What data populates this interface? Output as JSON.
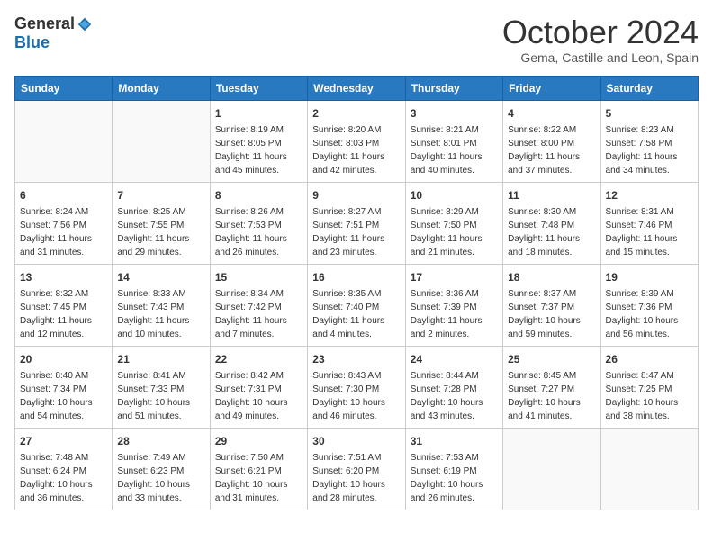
{
  "logo": {
    "general": "General",
    "blue": "Blue"
  },
  "title": {
    "month": "October 2024",
    "location": "Gema, Castille and Leon, Spain"
  },
  "weekdays": [
    "Sunday",
    "Monday",
    "Tuesday",
    "Wednesday",
    "Thursday",
    "Friday",
    "Saturday"
  ],
  "weeks": [
    [
      {
        "day": "",
        "sunrise": "",
        "sunset": "",
        "daylight": ""
      },
      {
        "day": "",
        "sunrise": "",
        "sunset": "",
        "daylight": ""
      },
      {
        "day": "1",
        "sunrise": "Sunrise: 8:19 AM",
        "sunset": "Sunset: 8:05 PM",
        "daylight": "Daylight: 11 hours and 45 minutes."
      },
      {
        "day": "2",
        "sunrise": "Sunrise: 8:20 AM",
        "sunset": "Sunset: 8:03 PM",
        "daylight": "Daylight: 11 hours and 42 minutes."
      },
      {
        "day": "3",
        "sunrise": "Sunrise: 8:21 AM",
        "sunset": "Sunset: 8:01 PM",
        "daylight": "Daylight: 11 hours and 40 minutes."
      },
      {
        "day": "4",
        "sunrise": "Sunrise: 8:22 AM",
        "sunset": "Sunset: 8:00 PM",
        "daylight": "Daylight: 11 hours and 37 minutes."
      },
      {
        "day": "5",
        "sunrise": "Sunrise: 8:23 AM",
        "sunset": "Sunset: 7:58 PM",
        "daylight": "Daylight: 11 hours and 34 minutes."
      }
    ],
    [
      {
        "day": "6",
        "sunrise": "Sunrise: 8:24 AM",
        "sunset": "Sunset: 7:56 PM",
        "daylight": "Daylight: 11 hours and 31 minutes."
      },
      {
        "day": "7",
        "sunrise": "Sunrise: 8:25 AM",
        "sunset": "Sunset: 7:55 PM",
        "daylight": "Daylight: 11 hours and 29 minutes."
      },
      {
        "day": "8",
        "sunrise": "Sunrise: 8:26 AM",
        "sunset": "Sunset: 7:53 PM",
        "daylight": "Daylight: 11 hours and 26 minutes."
      },
      {
        "day": "9",
        "sunrise": "Sunrise: 8:27 AM",
        "sunset": "Sunset: 7:51 PM",
        "daylight": "Daylight: 11 hours and 23 minutes."
      },
      {
        "day": "10",
        "sunrise": "Sunrise: 8:29 AM",
        "sunset": "Sunset: 7:50 PM",
        "daylight": "Daylight: 11 hours and 21 minutes."
      },
      {
        "day": "11",
        "sunrise": "Sunrise: 8:30 AM",
        "sunset": "Sunset: 7:48 PM",
        "daylight": "Daylight: 11 hours and 18 minutes."
      },
      {
        "day": "12",
        "sunrise": "Sunrise: 8:31 AM",
        "sunset": "Sunset: 7:46 PM",
        "daylight": "Daylight: 11 hours and 15 minutes."
      }
    ],
    [
      {
        "day": "13",
        "sunrise": "Sunrise: 8:32 AM",
        "sunset": "Sunset: 7:45 PM",
        "daylight": "Daylight: 11 hours and 12 minutes."
      },
      {
        "day": "14",
        "sunrise": "Sunrise: 8:33 AM",
        "sunset": "Sunset: 7:43 PM",
        "daylight": "Daylight: 11 hours and 10 minutes."
      },
      {
        "day": "15",
        "sunrise": "Sunrise: 8:34 AM",
        "sunset": "Sunset: 7:42 PM",
        "daylight": "Daylight: 11 hours and 7 minutes."
      },
      {
        "day": "16",
        "sunrise": "Sunrise: 8:35 AM",
        "sunset": "Sunset: 7:40 PM",
        "daylight": "Daylight: 11 hours and 4 minutes."
      },
      {
        "day": "17",
        "sunrise": "Sunrise: 8:36 AM",
        "sunset": "Sunset: 7:39 PM",
        "daylight": "Daylight: 11 hours and 2 minutes."
      },
      {
        "day": "18",
        "sunrise": "Sunrise: 8:37 AM",
        "sunset": "Sunset: 7:37 PM",
        "daylight": "Daylight: 10 hours and 59 minutes."
      },
      {
        "day": "19",
        "sunrise": "Sunrise: 8:39 AM",
        "sunset": "Sunset: 7:36 PM",
        "daylight": "Daylight: 10 hours and 56 minutes."
      }
    ],
    [
      {
        "day": "20",
        "sunrise": "Sunrise: 8:40 AM",
        "sunset": "Sunset: 7:34 PM",
        "daylight": "Daylight: 10 hours and 54 minutes."
      },
      {
        "day": "21",
        "sunrise": "Sunrise: 8:41 AM",
        "sunset": "Sunset: 7:33 PM",
        "daylight": "Daylight: 10 hours and 51 minutes."
      },
      {
        "day": "22",
        "sunrise": "Sunrise: 8:42 AM",
        "sunset": "Sunset: 7:31 PM",
        "daylight": "Daylight: 10 hours and 49 minutes."
      },
      {
        "day": "23",
        "sunrise": "Sunrise: 8:43 AM",
        "sunset": "Sunset: 7:30 PM",
        "daylight": "Daylight: 10 hours and 46 minutes."
      },
      {
        "day": "24",
        "sunrise": "Sunrise: 8:44 AM",
        "sunset": "Sunset: 7:28 PM",
        "daylight": "Daylight: 10 hours and 43 minutes."
      },
      {
        "day": "25",
        "sunrise": "Sunrise: 8:45 AM",
        "sunset": "Sunset: 7:27 PM",
        "daylight": "Daylight: 10 hours and 41 minutes."
      },
      {
        "day": "26",
        "sunrise": "Sunrise: 8:47 AM",
        "sunset": "Sunset: 7:25 PM",
        "daylight": "Daylight: 10 hours and 38 minutes."
      }
    ],
    [
      {
        "day": "27",
        "sunrise": "Sunrise: 7:48 AM",
        "sunset": "Sunset: 6:24 PM",
        "daylight": "Daylight: 10 hours and 36 minutes."
      },
      {
        "day": "28",
        "sunrise": "Sunrise: 7:49 AM",
        "sunset": "Sunset: 6:23 PM",
        "daylight": "Daylight: 10 hours and 33 minutes."
      },
      {
        "day": "29",
        "sunrise": "Sunrise: 7:50 AM",
        "sunset": "Sunset: 6:21 PM",
        "daylight": "Daylight: 10 hours and 31 minutes."
      },
      {
        "day": "30",
        "sunrise": "Sunrise: 7:51 AM",
        "sunset": "Sunset: 6:20 PM",
        "daylight": "Daylight: 10 hours and 28 minutes."
      },
      {
        "day": "31",
        "sunrise": "Sunrise: 7:53 AM",
        "sunset": "Sunset: 6:19 PM",
        "daylight": "Daylight: 10 hours and 26 minutes."
      },
      {
        "day": "",
        "sunrise": "",
        "sunset": "",
        "daylight": ""
      },
      {
        "day": "",
        "sunrise": "",
        "sunset": "",
        "daylight": ""
      }
    ]
  ]
}
